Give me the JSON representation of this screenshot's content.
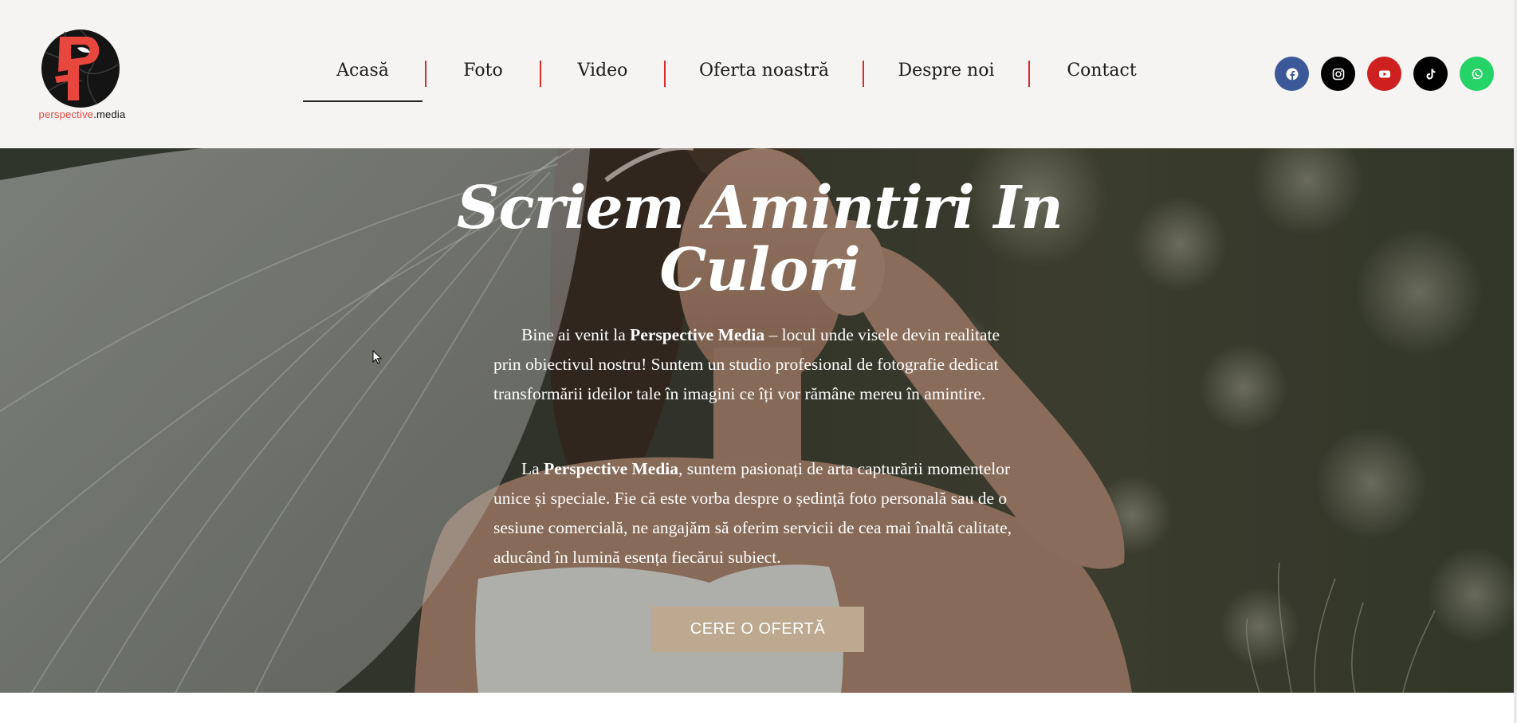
{
  "brand": {
    "logo_icon": "perspective-media-logo",
    "name_part1": "perspective",
    "name_part2": ".media",
    "accent_color": "#e8473e"
  },
  "nav": {
    "items": [
      {
        "label": "Acasă",
        "active": true
      },
      {
        "label": "Foto",
        "active": false
      },
      {
        "label": "Video",
        "active": false
      },
      {
        "label": "Oferta noastră",
        "active": false
      },
      {
        "label": "Despre noi",
        "active": false
      },
      {
        "label": "Contact",
        "active": false
      }
    ],
    "separator_color": "#d92b2b"
  },
  "social": [
    {
      "icon": "facebook-icon",
      "color": "#3b5998"
    },
    {
      "icon": "instagram-icon",
      "color": "#000000"
    },
    {
      "icon": "youtube-icon",
      "color": "#cd201f"
    },
    {
      "icon": "tiktok-icon",
      "color": "#000000"
    },
    {
      "icon": "whatsapp-icon",
      "color": "#25d366"
    }
  ],
  "hero": {
    "title_line1": "Scriem Amintiri In",
    "title_line2": "Culori",
    "p1_a": "Bine ai venit la ",
    "p1_bold": "Perspective Media",
    "p1_b": " – locul unde visele devin realitate prin obiectivul nostru! Suntem un studio profesional de fotografie dedicat transformării ideilor tale în imagini ce îți vor rămâne mereu în amintire.",
    "p2_a": "La ",
    "p2_bold": "Perspective Media",
    "p2_b": ", suntem pasionați de arta capturării momentelor unice și speciale. Fie că este vorba despre o ședință foto personală sau de o sesiune comercială, ne angajăm să oferim servicii de cea mai înaltă calitate, aducând în lumină esența fiecărui subiect.",
    "cta_label": "CERE O OFERTĂ",
    "cta_color": "#bca98f"
  }
}
